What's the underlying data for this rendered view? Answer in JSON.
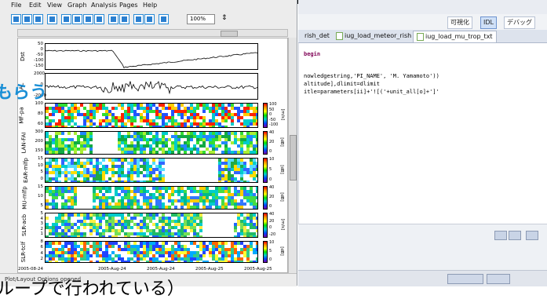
{
  "plot_window": {
    "menu": [
      "File",
      "Edit",
      "View",
      "Graph",
      "Analysis",
      "Pages",
      "Help"
    ],
    "zoom": "100%",
    "status": "Plot/Layout Options opened",
    "panels": [
      {
        "label": "Dst",
        "ticks": [
          "50",
          "0",
          "-50",
          "-100",
          "-150"
        ],
        "units": ""
      },
      {
        "label": "AL",
        "ticks": [
          "2000",
          "0",
          "-2000"
        ],
        "units": ""
      },
      {
        "label": "MF-pa",
        "ticks": [
          "100",
          "80",
          "60"
        ],
        "units": "[m/s]",
        "cbar": [
          "100",
          "50",
          "0",
          "-50",
          "-100"
        ]
      },
      {
        "label": "LAN-FAI",
        "ticks": [
          "300",
          "200",
          "150"
        ],
        "units": "[dB]",
        "cbar": [
          "40",
          "20",
          "0"
        ]
      },
      {
        "label": "EAR-mlfp",
        "ticks": [
          "15",
          "10",
          "5",
          "0"
        ],
        "units": "[dB]",
        "cbar": [
          "10",
          "5",
          "0"
        ]
      },
      {
        "label": "MU-mlfp",
        "ticks": [
          "15",
          "10",
          "5"
        ],
        "units": "[dB]",
        "cbar": [
          "40",
          "20",
          "0"
        ]
      },
      {
        "label": "SLR-acb",
        "ticks": [
          "5",
          "4",
          "3",
          "2",
          "1"
        ],
        "units": "[m/s]",
        "cbar": [
          "40",
          "20",
          "0",
          "-20"
        ]
      },
      {
        "label": "SLR-tclf",
        "ticks": [
          "8",
          "6",
          "4",
          "2"
        ],
        "units": "[dB]",
        "cbar": [
          "10",
          "5",
          "0"
        ]
      }
    ],
    "xaxis": [
      "2005-08-24",
      "2005-Aug-24",
      "2005-Aug-24",
      "2005-Aug-25",
      "2005-Aug-25"
    ]
  },
  "idl": {
    "perspective": [
      "可視化",
      "IDL",
      "デバッグ"
    ],
    "tabs": [
      {
        "label": "rish_det",
        "active": false
      },
      {
        "label": "iug_load_meteor_rish",
        "active": false
      },
      {
        "label": "iug_load_mu_trop_txt",
        "active": true
      }
    ],
    "code": [
      "begin",
      "nowledgestring,'PI_NAME', 'M. Yamamoto'))",
      "altitude],dlimit=dlimit",
      "itle=parameters[ii]+'![('+unit_all[o]+']'"
    ],
    "stars": "**************"
  },
  "overlay": {
    "jp_top": "もらう",
    "jp_bottom": "ループで行われている）"
  },
  "colors": {
    "accent": "#1a8fd6",
    "toolbar_blue": "#2a7fd0",
    "stars": "#c00000"
  }
}
